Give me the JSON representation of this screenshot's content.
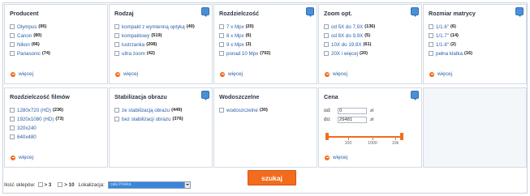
{
  "filters": [
    {
      "title": "Producent",
      "has_info": false,
      "options": [
        {
          "label": "Olympus",
          "count": "(95)"
        },
        {
          "label": "Canon",
          "count": "(80)"
        },
        {
          "label": "Nikon",
          "count": "(66)"
        },
        {
          "label": "Panasonic",
          "count": "(74)"
        }
      ],
      "more": "więcej"
    },
    {
      "title": "Rodzaj",
      "has_info": true,
      "options": [
        {
          "label": "kompakt z wymienną optyką",
          "count": "(40)"
        },
        {
          "label": "kompaktowy",
          "count": "(519)"
        },
        {
          "label": "lustrzanka",
          "count": "(208)"
        },
        {
          "label": "ultra zoom",
          "count": "(42)"
        }
      ],
      "more": "więcej"
    },
    {
      "title": "Rozdzielczość",
      "has_info": true,
      "options": [
        {
          "label": "7 x Mpx",
          "count": "(20)"
        },
        {
          "label": "8 x Mpx",
          "count": "(6)"
        },
        {
          "label": "9 x Mpx",
          "count": "(3)"
        },
        {
          "label": "ponad 10 Mpx",
          "count": "(702)"
        }
      ],
      "more": "więcej"
    },
    {
      "title": "Zoom opt.",
      "has_info": true,
      "options": [
        {
          "label": "od 5X do 7,9X",
          "count": "(136)"
        },
        {
          "label": "od 8X do 9,9X",
          "count": "(5)"
        },
        {
          "label": "10X do 19,9X",
          "count": "(61)"
        },
        {
          "label": "20X i więcej",
          "count": "(20)"
        }
      ],
      "more": "więcej"
    },
    {
      "title": "Rozmiar matrycy",
      "has_info": true,
      "options": [
        {
          "label": "1/1.6\"",
          "count": "(6)"
        },
        {
          "label": "1/1.7\"",
          "count": "(14)"
        },
        {
          "label": "1/1.8\"",
          "count": "(2)"
        },
        {
          "label": "pełna klatka",
          "count": "(16)"
        }
      ],
      "more": "więcej"
    },
    {
      "title": "Rozdzielczość filmów",
      "has_info": false,
      "options": [
        {
          "label": "1280x720 (HD)",
          "count": "(236)"
        },
        {
          "label": "1920x1080 (HD)",
          "count": "(73)"
        },
        {
          "label": "320x240",
          "count": ""
        },
        {
          "label": "640x480",
          "count": ""
        }
      ],
      "more": "więcej"
    },
    {
      "title": "Stabilizacja obrazu",
      "has_info": true,
      "options": [
        {
          "label": "ze stabilizacją obrazu",
          "count": "(449)"
        },
        {
          "label": "bez stabilizacji obrazu",
          "count": "(376)"
        }
      ],
      "more": ""
    },
    {
      "title": "Wodoszczelne",
      "has_info": false,
      "options": [
        {
          "label": "wodoszczelne",
          "count": "(30)"
        }
      ],
      "more": ""
    }
  ],
  "price": {
    "title": "Cena",
    "from_label": "od:",
    "from_value": "0",
    "to_label": "do:",
    "to_value": "29481",
    "unit": "zł",
    "ticks": [
      "100",
      "1000",
      "10k"
    ],
    "more": "więcej"
  },
  "bottom": {
    "shops_label": "Ilość sklepów:",
    "opt1": "> 3",
    "opt2": "> 10",
    "location_label": "Lokalizacja:",
    "location_value": "cała Polska"
  },
  "search_button": "szukaj",
  "colors": {
    "accent_orange": "#f36b1c",
    "link_blue": "#2a5fa8",
    "info_blue": "#4a90d9",
    "border": "#d3dbe5"
  }
}
